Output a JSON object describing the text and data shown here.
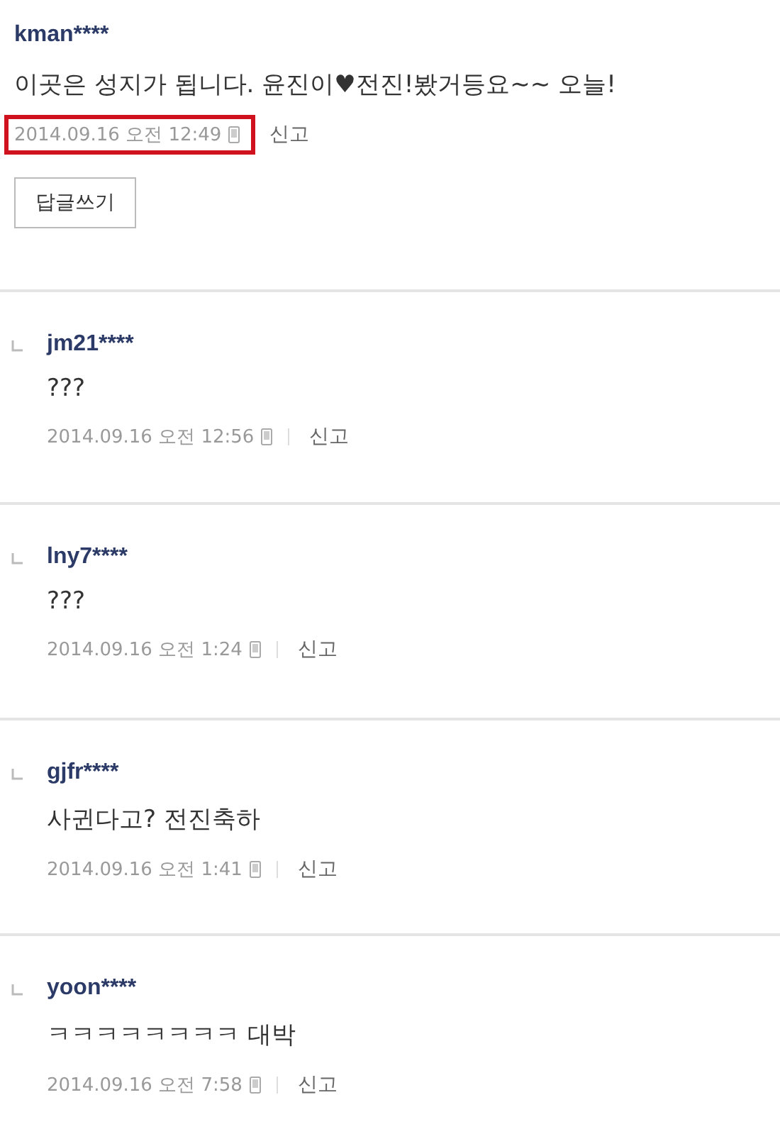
{
  "comment": {
    "author": "kman****",
    "text": "이곳은 성지가 됩니다. 윤진이♥전진!봤거등요~~ 오늘!",
    "date": "2014.09.16 오전 12:49",
    "highlighted": true,
    "report": "신고",
    "reply_button": "답글쓰기"
  },
  "replies": [
    {
      "author": "jm21****",
      "text": "???",
      "date": "2014.09.16 오전 12:56",
      "highlighted": false,
      "report": "신고"
    },
    {
      "author": "lny7****",
      "text": "???",
      "date": "2014.09.16 오전 1:24",
      "highlighted": false,
      "report": "신고"
    },
    {
      "author": "gjfr****",
      "text": "사귄다고? 전진축하",
      "date": "2014.09.16 오전 1:41",
      "highlighted": false,
      "report": "신고"
    },
    {
      "author": "yoon****",
      "text": "ㅋㅋㅋㅋㅋㅋㅋㅋ 대박",
      "date": "2014.09.16 오전 7:58",
      "highlighted": false,
      "report": "신고"
    }
  ]
}
